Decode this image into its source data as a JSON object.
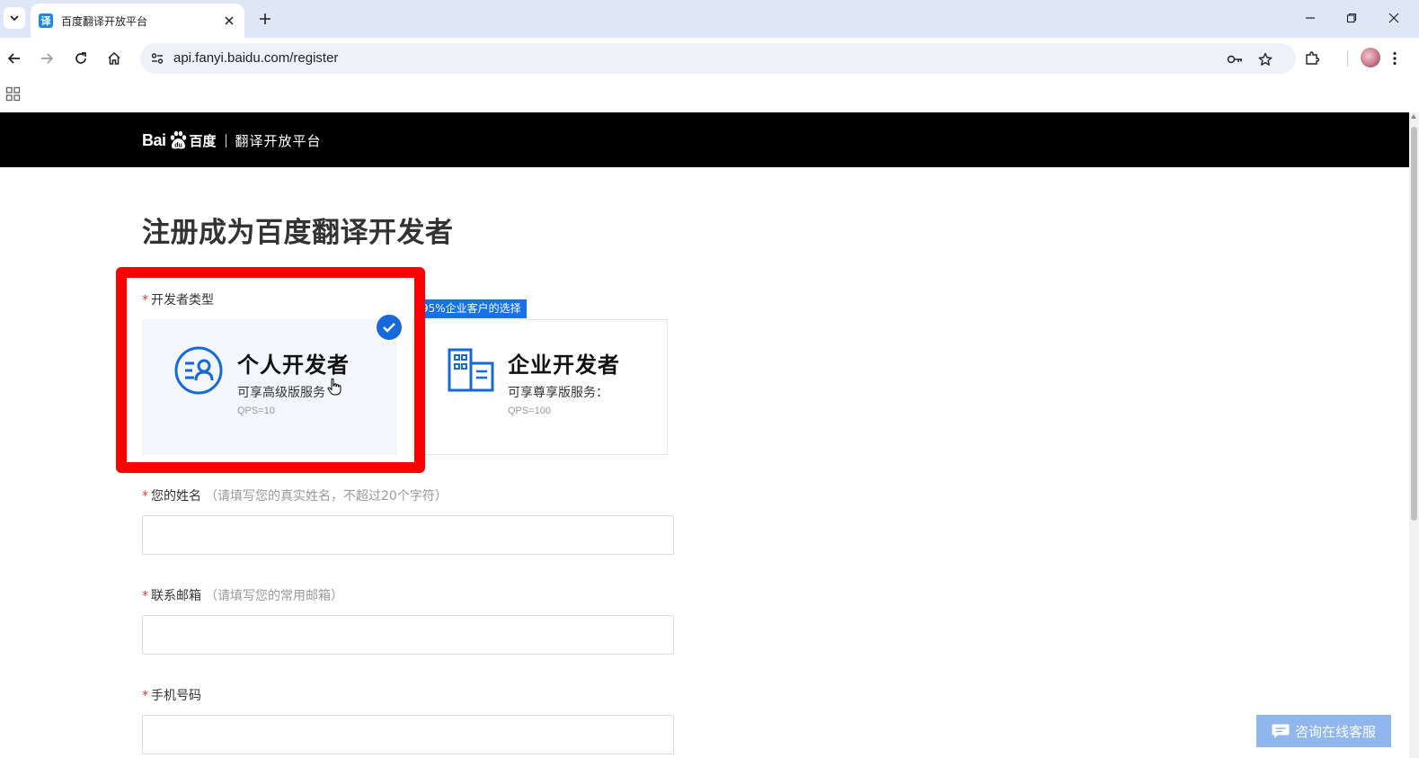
{
  "browser": {
    "tab_title": "百度翻译开放平台",
    "tab_favicon_text": "译",
    "url": "api.fanyi.baidu.com/register"
  },
  "header": {
    "logo_bai": "Bai",
    "logo_cn": "百度",
    "platform_name": "翻译开放平台"
  },
  "page": {
    "title": "注册成为百度翻译开发者",
    "developer_type": {
      "required_mark": "*",
      "label": "开发者类型",
      "enterprise_tag": "95%企业客户的选择",
      "options": [
        {
          "title": "个人开发者",
          "desc": "可享高级版服务",
          "qps": "QPS=10",
          "selected": true
        },
        {
          "title": "企业开发者",
          "desc": "可享尊享版服务：",
          "qps": "QPS=100",
          "selected": false
        }
      ]
    },
    "fields": [
      {
        "required_mark": "*",
        "label": "您的姓名",
        "hint": "（请填写您的真实姓名，不超过20个字符）",
        "value": ""
      },
      {
        "required_mark": "*",
        "label": "联系邮箱",
        "hint": "（请填写您的常用邮箱）",
        "value": ""
      },
      {
        "required_mark": "*",
        "label": "手机号码",
        "hint": "",
        "value": ""
      }
    ]
  },
  "chat": {
    "label": "咨询在线客服"
  },
  "colors": {
    "accent": "#1768d8",
    "highlight": "#ff0000",
    "header_bg": "#000000",
    "required": "#e03c31"
  },
  "icons": [
    "tab-list-icon",
    "close-icon",
    "plus-icon",
    "minimize-icon",
    "restore-icon",
    "back-icon",
    "forward-icon",
    "reload-icon",
    "home-icon",
    "site-info-icon",
    "password-key-icon",
    "star-icon",
    "extensions-icon",
    "menu-icon",
    "apps-icon",
    "personal-developer-icon",
    "enterprise-building-icon",
    "check-icon",
    "chat-bubble-icon"
  ]
}
